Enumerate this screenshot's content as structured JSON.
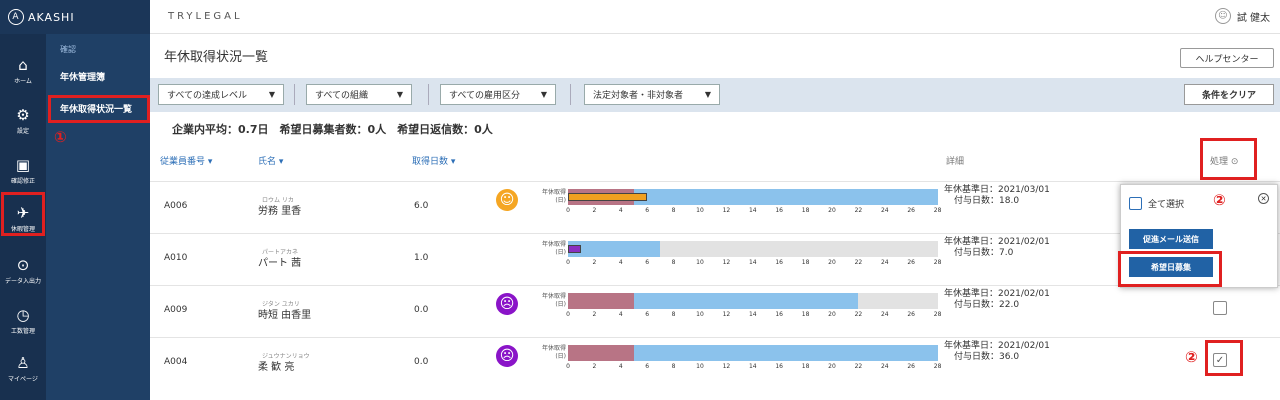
{
  "app": {
    "brand": "AKASHI",
    "company": "TRYLEGAL",
    "user": "試 健太"
  },
  "rail": [
    {
      "icon": "⌂",
      "icon_name": "home-icon",
      "label": "ホーム"
    },
    {
      "icon": "⚙",
      "icon_name": "gear-icon",
      "label": "設定"
    },
    {
      "icon": "▣",
      "icon_name": "clipboard-icon",
      "label": "確認修正"
    },
    {
      "icon": "✈",
      "icon_name": "vacation-icon",
      "label": "休暇管理"
    },
    {
      "icon": "⊙",
      "icon_name": "download-icon",
      "label": "データ入出力"
    },
    {
      "icon": "◷",
      "icon_name": "clock-icon",
      "label": "工数管理"
    },
    {
      "icon": "♙",
      "icon_name": "person-icon",
      "label": "マイページ"
    }
  ],
  "submenu": {
    "heading": "確認",
    "items": [
      "年休管理簿",
      "年休取得状況一覧"
    ]
  },
  "page": {
    "title": "年休取得状況一覧",
    "help": "ヘルプセンター",
    "clear": "条件をクリア"
  },
  "filters": [
    "すべての達成レベル",
    "すべての組織",
    "すべての雇用区分",
    "法定対象者・非対象者"
  ],
  "summary": "企業内平均：0.7日　希望日募集者数：0人　希望日返信数：0人",
  "columns": {
    "emp_no": "従業員番号 ▾",
    "name": "氏名 ▾",
    "days": "取得日数 ▾",
    "detail": "詳細",
    "action": "処理 ⊙"
  },
  "chart_label": [
    "年休取得",
    "(日)"
  ],
  "ticks": [
    "0",
    "2",
    "4",
    "6",
    "8",
    "10",
    "12",
    "14",
    "16",
    "18",
    "20",
    "22",
    "24",
    "26",
    "28"
  ],
  "rows": [
    {
      "emp_no": "A006",
      "kana": "ロウム リカ",
      "name": "労務 里香",
      "days": "6.0",
      "face": "☺",
      "face_color": "#f5a623",
      "entitled": 28,
      "obligation": 5,
      "taken": 6,
      "base_date": "年休基準日：2021/03/01",
      "granted": "付与日数：18.0",
      "checked": false
    },
    {
      "emp_no": "A010",
      "kana": "パートアカネ",
      "name": "パート 茜",
      "days": "1.0",
      "face": "",
      "face_color": "",
      "entitled": 7,
      "obligation": 0,
      "taken": 1,
      "base_date": "年休基準日：2021/02/01",
      "granted": "付与日数：7.0",
      "checked": false
    },
    {
      "emp_no": "A009",
      "kana": "ジタン ユカリ",
      "name": "時短 由香里",
      "days": "0.0",
      "face": "☹",
      "face_color": "#8a14c8",
      "entitled": 22,
      "obligation": 5,
      "taken": 0,
      "base_date": "年休基準日：2021/02/01",
      "granted": "付与日数：22.0",
      "checked": false
    },
    {
      "emp_no": "A004",
      "kana": "ジュウナンリョウ",
      "name": "柔 歓 亮",
      "days": "0.0",
      "face": "☹",
      "face_color": "#8a14c8",
      "entitled": 28,
      "obligation": 5,
      "taken": 0,
      "base_date": "年休基準日：2021/02/01",
      "granted": "付与日数：36.0",
      "checked": true
    }
  ],
  "popup": {
    "select_all": "全て選択",
    "btn1": "促進メール送信",
    "btn2": "希望日募集"
  },
  "annotations": {
    "one": "①",
    "two": "②"
  },
  "colors": {
    "accent": "#2d6fb7",
    "pink": "#b87485",
    "blue": "#8bc2ec",
    "highlight": "#e02020"
  }
}
